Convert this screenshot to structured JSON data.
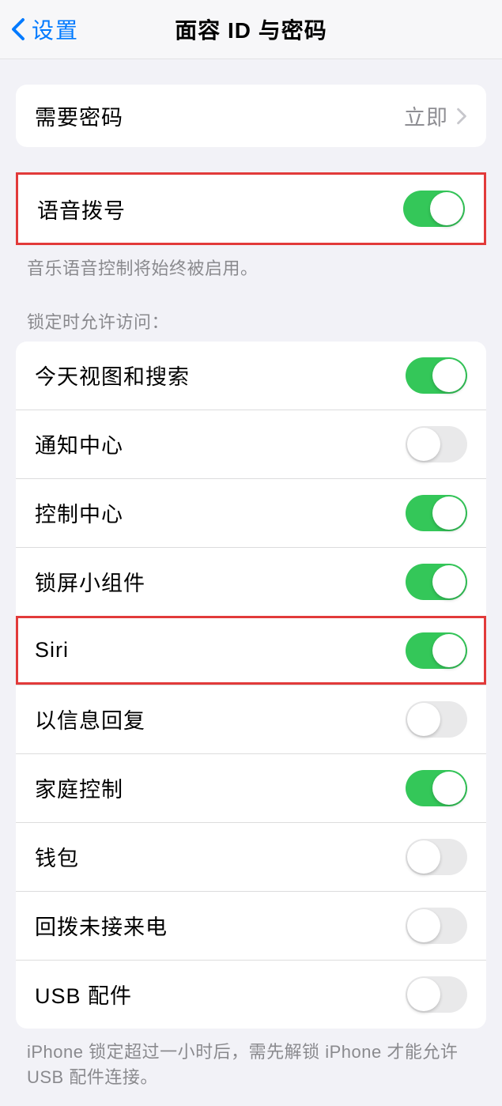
{
  "header": {
    "back_label": "设置",
    "title": "面容 ID 与密码"
  },
  "passcode_section": {
    "require_passcode": {
      "label": "需要密码",
      "value": "立即"
    }
  },
  "voice_dial": {
    "label": "语音拨号",
    "on": true,
    "footer": "音乐语音控制将始终被启用。"
  },
  "lock_access": {
    "header": "锁定时允许访问：",
    "items": [
      {
        "label": "今天视图和搜索",
        "on": true
      },
      {
        "label": "通知中心",
        "on": false
      },
      {
        "label": "控制中心",
        "on": true
      },
      {
        "label": "锁屏小组件",
        "on": true
      },
      {
        "label": "Siri",
        "on": true
      },
      {
        "label": "以信息回复",
        "on": false
      },
      {
        "label": "家庭控制",
        "on": true
      },
      {
        "label": "钱包",
        "on": false
      },
      {
        "label": "回拨未接来电",
        "on": false
      },
      {
        "label": "USB 配件",
        "on": false
      }
    ],
    "footer": "iPhone 锁定超过一小时后，需先解锁 iPhone 才能允许USB 配件连接。"
  }
}
